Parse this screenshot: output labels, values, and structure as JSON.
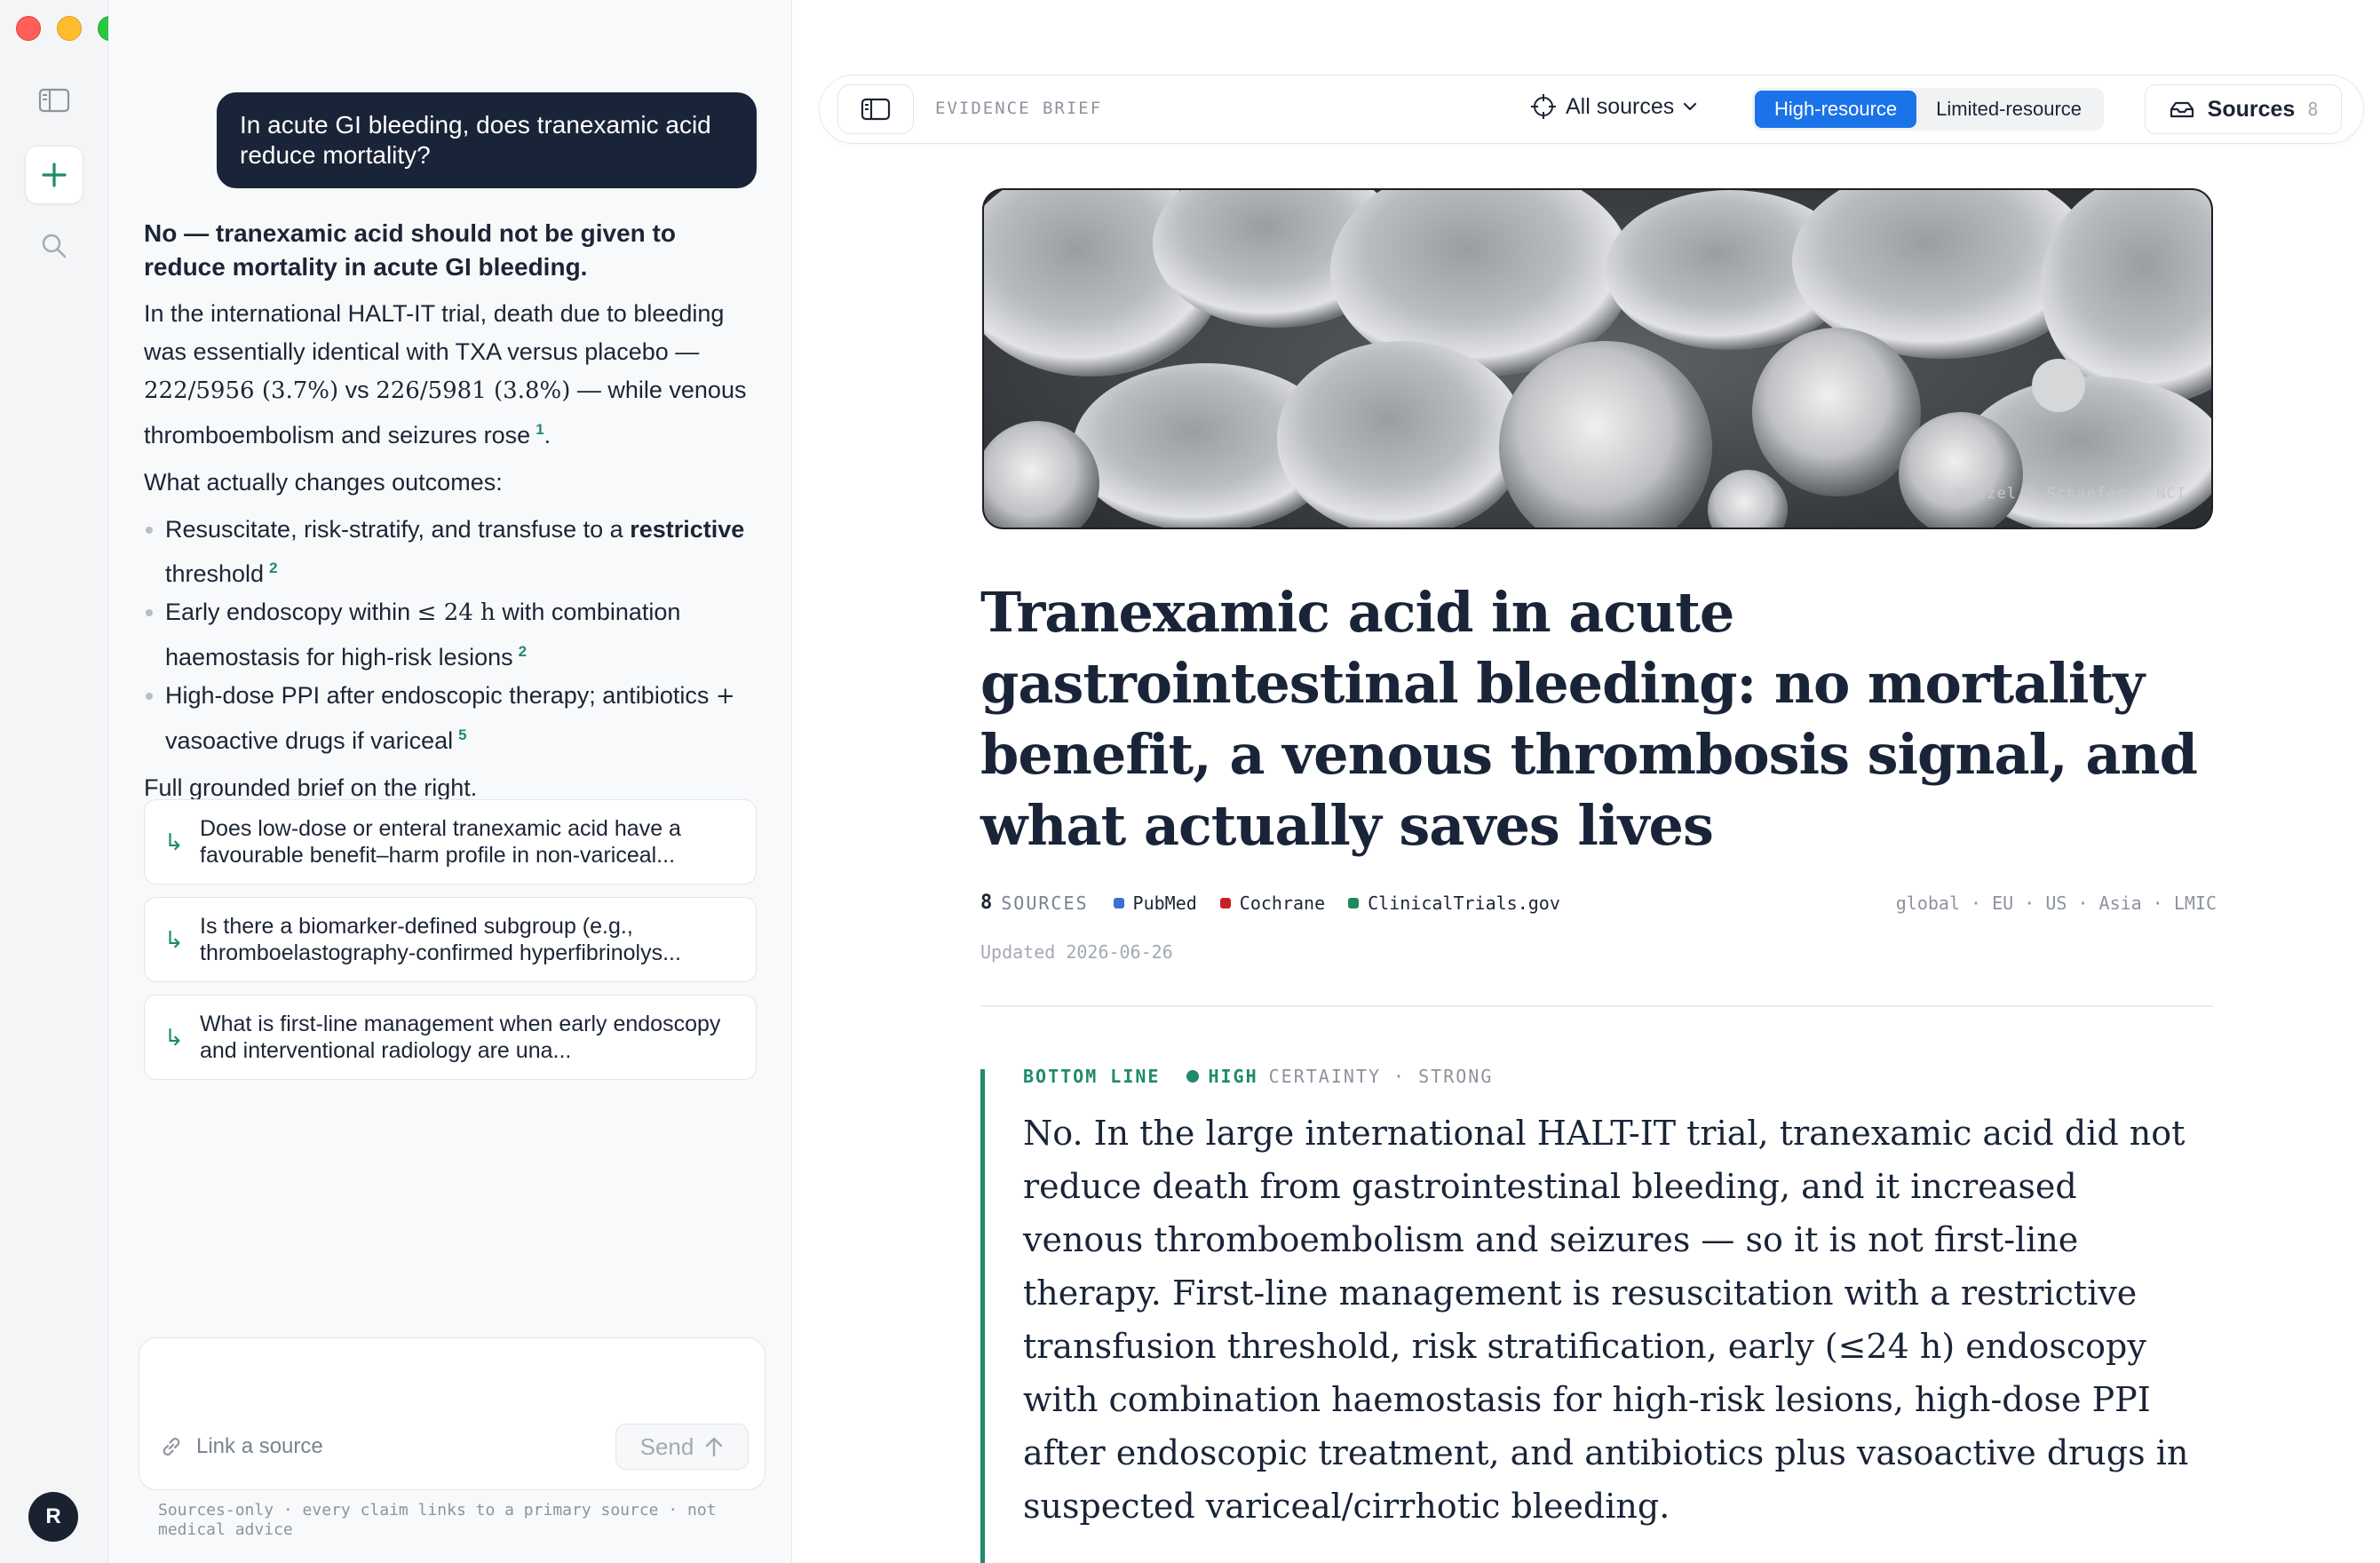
{
  "sidebar": {
    "avatar_initial": "R",
    "icons": [
      "sidebar-toggle-icon",
      "plus-icon",
      "search-icon"
    ]
  },
  "chat": {
    "user_question": "In acute GI bleeding, does tranexamic acid reduce mortality?",
    "answer": {
      "headline": "No — tranexamic acid should not be given to reduce mortality in acute GI bleeding.",
      "p1_a": "In the international HALT-IT trial, death due to bleeding was essentially identical with TXA versus placebo — ",
      "p1_math1": "222/5956 (3.7%)",
      "p1_b": " vs ",
      "p1_math2": "226/5981 (3.8%)",
      "p1_c": " — while venous thromboembolism and seizures rose",
      "p1_cite": "1",
      "p1_end": ".",
      "p2": "What actually changes outcomes:",
      "bullets": [
        {
          "a": "Resuscitate, risk-stratify, and transfuse to a ",
          "bold": "restrictive",
          "b": " threshold",
          "cite": "2"
        },
        {
          "a": "Early endoscopy within ",
          "math": "≤ 24 h",
          "b": " with combination haemostasis for high-risk lesions",
          "cite": "2"
        },
        {
          "a": "High-dose PPI after endoscopic therapy; antibiotics ",
          "math": "+",
          "b": " vasoactive drugs if variceal",
          "cite": "5"
        }
      ],
      "closing": "Full grounded brief on the right."
    },
    "followups": [
      "Does low-dose or enteral tranexamic acid have a favourable benefit–harm profile in non-variceal...",
      "Is there a biomarker-defined subgroup (e.g., thromboelastography-confirmed hyperfibrinolys...",
      "What is first-line management when early endoscopy and interventional radiology are una..."
    ],
    "composer": {
      "link_label": "Link a source",
      "send_label": "Send"
    },
    "disclaimer": "Sources-only · every claim links to a primary source · not medical advice"
  },
  "toolbar": {
    "label": "EVIDENCE BRIEF",
    "all_sources": "All sources",
    "segments": [
      "High-resource",
      "Limited-resource"
    ],
    "active_segment": "High-resource",
    "sources_label": "Sources",
    "sources_count": "8"
  },
  "article": {
    "image_credit": "Wetzel & Schaefer / NCI",
    "title": "Tranexamic acid in acute gastrointestinal bleeding: no mortality benefit, a venous thrombosis signal, and what actually saves lives",
    "source_count": "8",
    "source_label": "SOURCES",
    "sources": [
      {
        "name": "PubMed",
        "color": "#3b6fd4"
      },
      {
        "name": "Cochrane",
        "color": "#c8202a"
      },
      {
        "name": "ClinicalTrials.gov",
        "color": "#1f8a5c"
      }
    ],
    "regions": "global · EU · US · Asia · LMIC",
    "updated": "Updated 2026-06-26",
    "bottom_line": {
      "label": "BOTTOM LINE",
      "certainty_level": "HIGH",
      "certainty_rest": "CERTAINTY · STRONG",
      "text": "No. In the large international HALT-IT trial, tranexamic acid did not reduce death from gastrointestinal bleeding, and it increased venous thromboembolism and seizures — so it is not first-line therapy. First-line management is resuscitation with a restrictive transfusion threshold, risk stratification, early (≤24 h) endoscopy with combination haemostasis for high-risk lesions, high-dose PPI after endoscopic treatment, and antibiotics plus vasoactive drugs in suspected variceal/cirrhotic bleeding."
    }
  },
  "colors": {
    "accent_green": "#1f8a6c",
    "navy": "#1a2438",
    "active_blue": "#1a73e8"
  }
}
